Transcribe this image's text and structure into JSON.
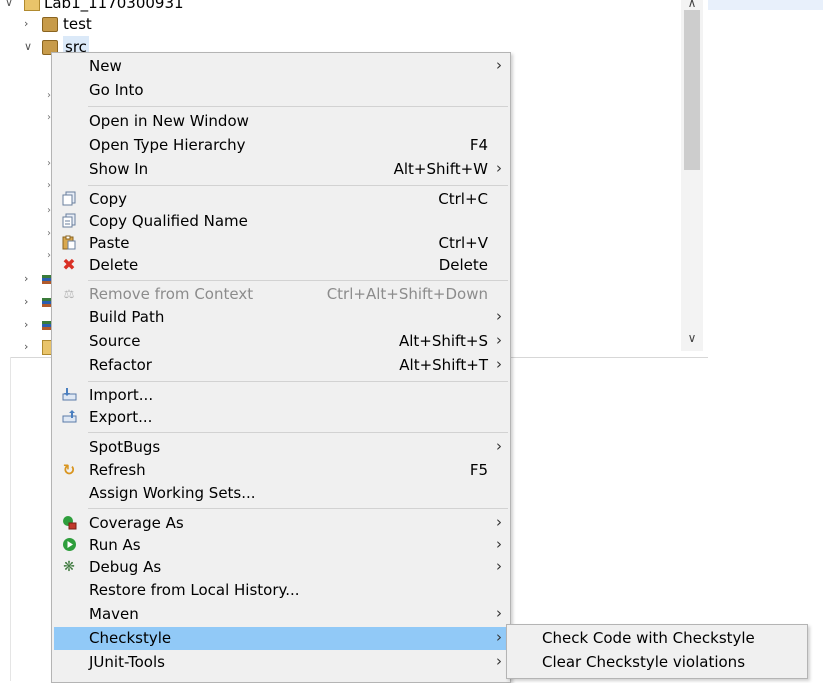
{
  "tree": {
    "project_label": "Lab1_1170300931",
    "items": [
      {
        "label": "test",
        "icon": "package-folder-icon"
      },
      {
        "label": "src",
        "icon": "package-folder-icon"
      }
    ]
  },
  "context_menu": {
    "items": [
      {
        "label": "New",
        "shortcut": "",
        "submenu": true
      },
      {
        "label": "Go Into",
        "shortcut": ""
      },
      {
        "label": "Open in New Window",
        "shortcut": ""
      },
      {
        "label": "Open Type Hierarchy",
        "shortcut": "F4"
      },
      {
        "label": "Show In",
        "shortcut": "Alt+Shift+W",
        "submenu": true
      },
      {
        "label": "Copy",
        "shortcut": "Ctrl+C",
        "icon": "copy-icon"
      },
      {
        "label": "Copy Qualified Name",
        "shortcut": "",
        "icon": "copy-qualified-icon"
      },
      {
        "label": "Paste",
        "shortcut": "Ctrl+V",
        "icon": "paste-icon"
      },
      {
        "label": "Delete",
        "shortcut": "Delete",
        "icon": "delete-icon"
      },
      {
        "label": "Remove from Context",
        "shortcut": "Ctrl+Alt+Shift+Down",
        "disabled": true,
        "icon": "remove-context-icon"
      },
      {
        "label": "Build Path",
        "shortcut": "",
        "submenu": true
      },
      {
        "label": "Source",
        "shortcut": "Alt+Shift+S",
        "submenu": true
      },
      {
        "label": "Refactor",
        "shortcut": "Alt+Shift+T",
        "submenu": true
      },
      {
        "label": "Import...",
        "shortcut": "",
        "icon": "import-icon"
      },
      {
        "label": "Export...",
        "shortcut": "",
        "icon": "export-icon"
      },
      {
        "label": "SpotBugs",
        "shortcut": "",
        "submenu": true
      },
      {
        "label": "Refresh",
        "shortcut": "F5",
        "icon": "refresh-icon"
      },
      {
        "label": "Assign Working Sets...",
        "shortcut": ""
      },
      {
        "label": "Coverage As",
        "shortcut": "",
        "submenu": true,
        "icon": "coverage-icon"
      },
      {
        "label": "Run As",
        "shortcut": "",
        "submenu": true,
        "icon": "run-icon"
      },
      {
        "label": "Debug As",
        "shortcut": "",
        "submenu": true,
        "icon": "debug-icon"
      },
      {
        "label": "Restore from Local History...",
        "shortcut": ""
      },
      {
        "label": "Maven",
        "shortcut": "",
        "submenu": true
      },
      {
        "label": "Checkstyle",
        "shortcut": "",
        "submenu": true,
        "highlighted": true
      },
      {
        "label": "JUnit-Tools",
        "shortcut": "",
        "submenu": true
      }
    ]
  },
  "checkstyle_submenu": {
    "items": [
      {
        "label": "Check Code with Checkstyle"
      },
      {
        "label": "Clear Checkstyle violations"
      }
    ]
  },
  "colors": {
    "menu_bg": "#f0f0f0",
    "highlight": "#91c9f7",
    "disabled_text": "#8c8c8c",
    "delete_red": "#d93025",
    "run_green": "#2e9e3c"
  }
}
